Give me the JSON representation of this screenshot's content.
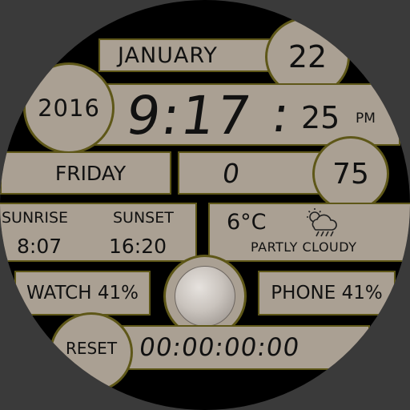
{
  "date": {
    "month": "JANUARY",
    "day": "22",
    "year": "2016",
    "weekday": "FRIDAY"
  },
  "time": {
    "hm": "9:17",
    "sep": ":",
    "seconds": "25",
    "ampm": "PM"
  },
  "steps": {
    "value": "0"
  },
  "heart_rate": {
    "value": "75"
  },
  "sun": {
    "sunrise_label": "SUNRISE",
    "sunset_label": "SUNSET",
    "sunrise": "8:07",
    "sunset": "16:20"
  },
  "weather": {
    "temperature": "6°C",
    "condition": "PARTLY CLOUDY",
    "icon": "partly-cloudy-rain-icon"
  },
  "battery": {
    "watch": "WATCH 41%",
    "phone": "PHONE 41%"
  },
  "stopwatch": {
    "reset_label": "RESET",
    "value": "00:00:00:00"
  },
  "colors": {
    "panel": "#aaa093",
    "border": "#5e5718",
    "background": "#000000",
    "outer": "#3a3a3a"
  }
}
